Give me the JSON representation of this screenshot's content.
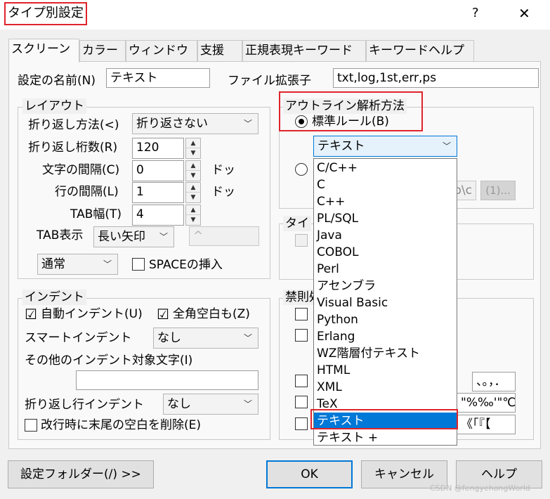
{
  "window": {
    "title": "タイプ別設定",
    "help_glyph": "?",
    "close_glyph": "✕"
  },
  "tabs": [
    {
      "label": "スクリーン"
    },
    {
      "label": "カラー"
    },
    {
      "label": "ウィンドウ"
    },
    {
      "label": "支援"
    },
    {
      "label": "正規表現キーワード"
    },
    {
      "label": "キーワードヘルプ"
    }
  ],
  "settings": {
    "name_label": "設定の名前(N)",
    "name_value": "テキスト",
    "ext_label": "ファイル拡張子",
    "ext_value": "txt,log,1st,err,ps"
  },
  "layout": {
    "title": "レイアウト",
    "wrap_method_label": "折り返し方法(<)",
    "wrap_method_value": "折り返さない",
    "wrap_cols_label": "折り返し桁数(R)",
    "wrap_cols_value": "120",
    "char_spacing_label": "文字の間隔(C)",
    "char_spacing_value": "0",
    "char_spacing_unit": "ドッ",
    "line_spacing_label": "行の間隔(L)",
    "line_spacing_value": "1",
    "line_spacing_unit": "ドッ",
    "tab_width_label": "TAB幅(T)",
    "tab_width_value": "4",
    "tab_display_label": "TAB表示",
    "tab_display_value": "長い矢印",
    "tab_char_value": "^",
    "mode_value": "通常",
    "space_insert_label": "SPACEの挿入"
  },
  "indent": {
    "title": "インデント",
    "auto_label": "自動インデント(U)",
    "auto_checked": "☑",
    "fullwidth_label": "全角空白も(Z)",
    "fullwidth_checked": "☑",
    "smart_label": "スマートインデント",
    "smart_value": "なし",
    "other_chars_label": "その他のインデント対象文字(I)",
    "other_chars_value": "",
    "wrap_indent_label": "折り返し行インデント",
    "wrap_indent_value": "なし",
    "trim_label": "改行時に末尾の空白を削除(E)"
  },
  "outline": {
    "title": "アウトライン解析方法",
    "standard_rule_label": "標準ルール(B)",
    "rule_value": "テキスト",
    "rule_file_partial": "p\\c",
    "rule_file_button": "(1)...",
    "options": [
      "C/C++",
      "C",
      "C++",
      "PL/SQL",
      "Java",
      "COBOL",
      "Perl",
      "アセンブラ",
      "Visual Basic",
      "Python",
      "Erlang",
      "WZ階層付テキスト",
      "HTML",
      "XML",
      "TeX",
      "テキスト",
      "テキスト +"
    ],
    "selected_index": 15
  },
  "right_groups": {
    "type_title_partial": "タイ",
    "kinsoku_title_partial": "禁則処",
    "field1_partial": "、。，．",
    "field2_partial": "\"%‰'\"℃、",
    "field3_partial": "《「『【"
  },
  "buttons": {
    "folder": "設定フォルダー(/) >>",
    "ok": "OK",
    "cancel": "キャンセル",
    "help": "ヘルプ"
  },
  "watermark": "CSDN @fengyehongWorld"
}
